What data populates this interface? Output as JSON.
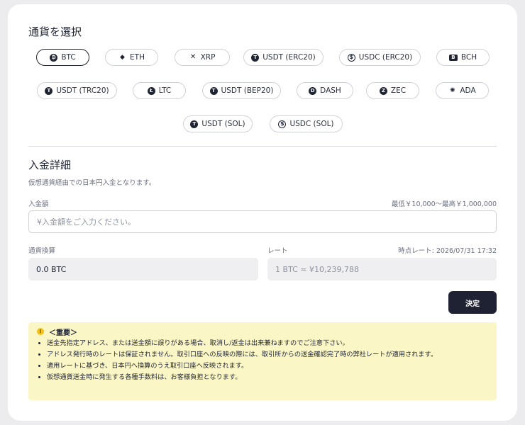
{
  "currency_section": {
    "title": "通貨を選択",
    "coins": [
      {
        "label": "BTC",
        "glyph": "₿",
        "icon": "bitcoin-icon"
      },
      {
        "label": "ETH",
        "glyph": "◆",
        "icon": "ethereum-icon"
      },
      {
        "label": "XRP",
        "glyph": "✕",
        "icon": "xrp-icon"
      },
      {
        "label": "USDT (ERC20)",
        "glyph": "T",
        "icon": "tether-icon"
      },
      {
        "label": "USDC (ERC20)",
        "glyph": "$",
        "icon": "usdc-icon"
      },
      {
        "label": "BCH",
        "glyph": "B",
        "icon": "bitcoin-cash-icon"
      },
      {
        "label": "USDT (TRC20)",
        "glyph": "T",
        "icon": "tether-icon"
      },
      {
        "label": "LTC",
        "glyph": "Ł",
        "icon": "litecoin-icon"
      },
      {
        "label": "USDT (BEP20)",
        "glyph": "T",
        "icon": "tether-icon"
      },
      {
        "label": "DASH",
        "glyph": "D",
        "icon": "dash-icon"
      },
      {
        "label": "ZEC",
        "glyph": "Z",
        "icon": "zcash-icon"
      },
      {
        "label": "ADA",
        "glyph": "✺",
        "icon": "cardano-icon"
      },
      {
        "label": "USDT (SOL)",
        "glyph": "T",
        "icon": "tether-icon"
      },
      {
        "label": "USDC (SOL)",
        "glyph": "$",
        "icon": "usdc-icon"
      }
    ],
    "selected": "BTC"
  },
  "deposit": {
    "title": "入金詳細",
    "note": "仮想通貨経由での日本円入金となります。",
    "amount_label": "入金額",
    "amount_range": "最低￥10,000〜最高￥1,000,000",
    "amount_value": "",
    "amount_placeholder": "¥入金額をご入力ください。",
    "conversion_label": "通貨換算",
    "conversion_value": "0.0 BTC",
    "rate_label": "レート",
    "rate_time": "時点レート: 2026/07/31 17:32",
    "rate_value": "1 BTC ≈ ¥10,239,788",
    "submit_label": "決定"
  },
  "notice": {
    "title": "＜重要＞",
    "items": [
      "送金先指定アドレス、または送金額に誤りがある場合、取消し/返金は出来兼ねますのでご注意下さい。",
      "アドレス発行時のレートは保証されません。取引口座への反映の際には、取引所からの送金確認完了時の弊社レートが適用されます。",
      "適用レートに基づき、日本円へ換算のうえ取引口座へ反映されます。",
      "仮想通貨送金時に発生する各種手数料は、お客様負担となります。"
    ]
  },
  "colors": {
    "primary": "#1e2233",
    "notice_bg": "#fbf6c5",
    "background": "#ececef"
  }
}
